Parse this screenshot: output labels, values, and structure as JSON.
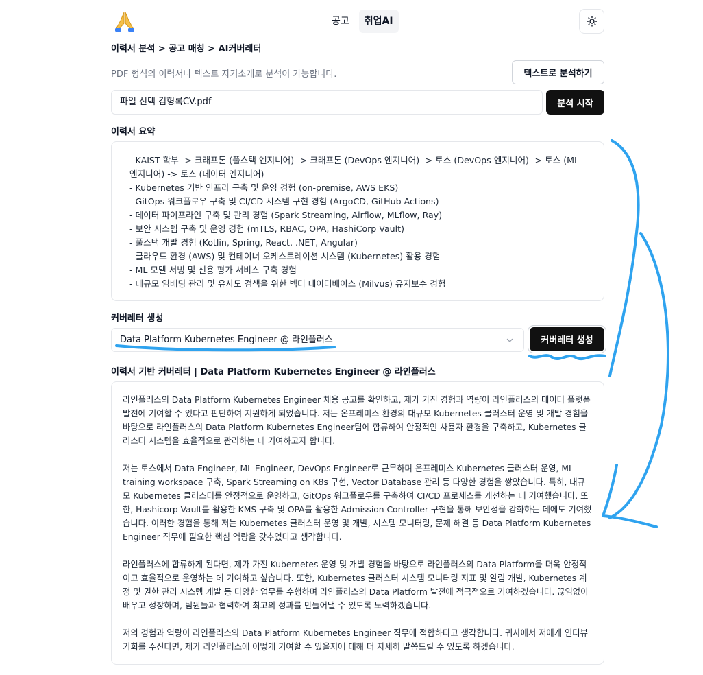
{
  "header": {
    "logo_glyph": "🙏",
    "tabs": [
      {
        "label": "공고",
        "active": false
      },
      {
        "label": "취업AI",
        "active": true
      }
    ],
    "theme_icon": "sun-icon"
  },
  "breadcrumb": "이력서 분석 > 공고 매칭 > AI커버레터",
  "upload": {
    "hint": "PDF 형식의 이력서나 텍스트 자기소개로 분석이 가능합니다.",
    "text_analyze_button": "텍스트로 분석하기",
    "file_input_value": "파일 선택 김형록CV.pdf",
    "start_button": "분석 시작"
  },
  "summary": {
    "title": "이력서 요약",
    "lines": [
      "- KAIST 학부 -> 크래프톤 (풀스택 엔지니어) -> 크래프톤 (DevOps 엔지니어) -> 토스 (DevOps 엔지니어) -> 토스 (ML",
      "엔지니어) -> 토스 (데이터 엔지니어)",
      "- Kubernetes 기반 인프라 구축 및 운영 경험 (on-premise, AWS EKS)",
      "- GitOps 워크플로우 구축 및 CI/CD 시스템 구현 경험 (ArgoCD, GitHub Actions)",
      "- 데이터 파이프라인 구축 및 관리 경험 (Spark Streaming, Airflow, MLflow, Ray)",
      "- 보안 시스템 구축 및 운영 경험 (mTLS, RBAC, OPA, HashiCorp Vault)",
      "- 풀스택 개발 경험 (Kotlin, Spring, React, .NET, Angular)",
      "- 클라우드 환경 (AWS) 및 컨테이너 오케스트레이션 시스템 (Kubernetes) 활용 경험",
      "- ML 모델 서빙 및 신용 평가 서비스 구축 경험",
      "- 대규모 임베딩 관리 및 유사도 검색을 위한 벡터 데이터베이스 (Milvus) 유지보수 경험"
    ]
  },
  "cover": {
    "title": "커버레터 생성",
    "selected_job": "Data Platform Kubernetes Engineer @ 라인플러스",
    "generate_button": "커버레터 생성"
  },
  "letter": {
    "title": "이력서 기반 커버레터 | Data Platform Kubernetes Engineer @ 라인플러스",
    "paragraphs": [
      "라인플러스의 Data Platform Kubernetes Engineer 채용 공고를 확인하고, 제가 가진 경험과 역량이 라인플러스의 데이터 플랫폼 발전에 기여할 수 있다고 판단하여 지원하게 되었습니다. 저는 온프레미스 환경의 대규모 Kubernetes 클러스터 운영 및 개발 경험을 바탕으로 라인플러스의 Data Platform Kubernetes Engineer팀에 합류하여 안정적인 사용자 환경을 구축하고, Kubernetes 클러스터 시스템을 효율적으로 관리하는 데 기여하고자 합니다.",
      "저는 토스에서 Data Engineer, ML Engineer, DevOps Engineer로 근무하며 온프레미스 Kubernetes 클러스터 운영, ML training workspace 구축, Spark Streaming on K8s 구현, Vector Database 관리 등 다양한 경험을 쌓았습니다. 특히, 대규모 Kubernetes 클러스터를 안정적으로 운영하고, GitOps 워크플로우를 구축하여 CI/CD 프로세스를 개선하는 데 기여했습니다. 또한, Hashicorp Vault를 활용한 KMS 구축 및 OPA를 활용한 Admission Controller 구현을 통해 보안성을 강화하는 데에도 기여했습니다. 이러한 경험을 통해 저는 Kubernetes 클러스터 운영 및 개발, 시스템 모니터링, 문제 해결 등 Data Platform Kubernetes Engineer 직무에 필요한 핵심 역량을 갖추었다고 생각합니다.",
      "라인플러스에 합류하게 된다면, 제가 가진 Kubernetes 운영 및 개발 경험을 바탕으로 라인플러스의 Data Platform을 더욱 안정적이고 효율적으로 운영하는 데 기여하고 싶습니다. 또한, Kubernetes 클러스터 시스템 모니터링 지표 및 알림 개발, Kubernetes 계정 및 권한 관리 시스템 개발 등 다양한 업무를 수행하며 라인플러스의 Data Platform 발전에 적극적으로 기여하겠습니다. 끊임없이 배우고 성장하며, 팀원들과 협력하여 최고의 성과를 만들어낼 수 있도록 노력하겠습니다.",
      "저의 경험과 역량이 라인플러스의 Data Platform Kubernetes Engineer 직무에 적합하다고 생각합니다. 귀사에서 저에게 인터뷰 기회를 주신다면, 제가 라인플러스에 어떻게 기여할 수 있을지에 대해 더 자세히 말씀드릴 수 있도록 하겠습니다."
    ]
  },
  "annotation_color": "#2fa3ef"
}
